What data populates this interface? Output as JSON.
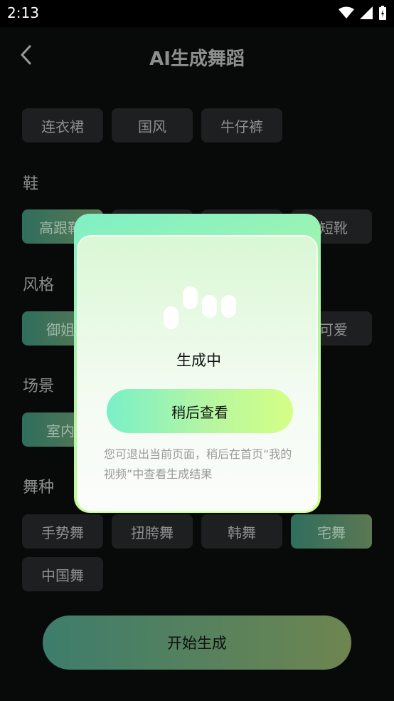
{
  "status": {
    "time": "2:13"
  },
  "header": {
    "title": "AI生成舞蹈"
  },
  "clothes": {
    "options": [
      "连衣裙",
      "国风",
      "牛仔裤"
    ]
  },
  "shoes": {
    "label": "鞋",
    "options": [
      "高跟鞋",
      "",
      "",
      "短靴"
    ]
  },
  "style": {
    "label": "风格",
    "options": [
      "御姐",
      "",
      "",
      "可爱"
    ]
  },
  "scene": {
    "label": "场景",
    "options": [
      "室内"
    ]
  },
  "dance": {
    "label": "舞种",
    "options": [
      "手势舞",
      "扭胯舞",
      "韩舞",
      "宅舞",
      "中国舞"
    ]
  },
  "start_button": "开始生成",
  "modal": {
    "status": "生成中",
    "button": "稍后查看",
    "hint": "您可退出当前页面，稍后在首页“我的视频”中查看生成结果"
  },
  "colors": {
    "accent_start": "#7ff0c6",
    "accent_end": "#d6ff8a",
    "selected_chip": "#2f6e5d"
  }
}
